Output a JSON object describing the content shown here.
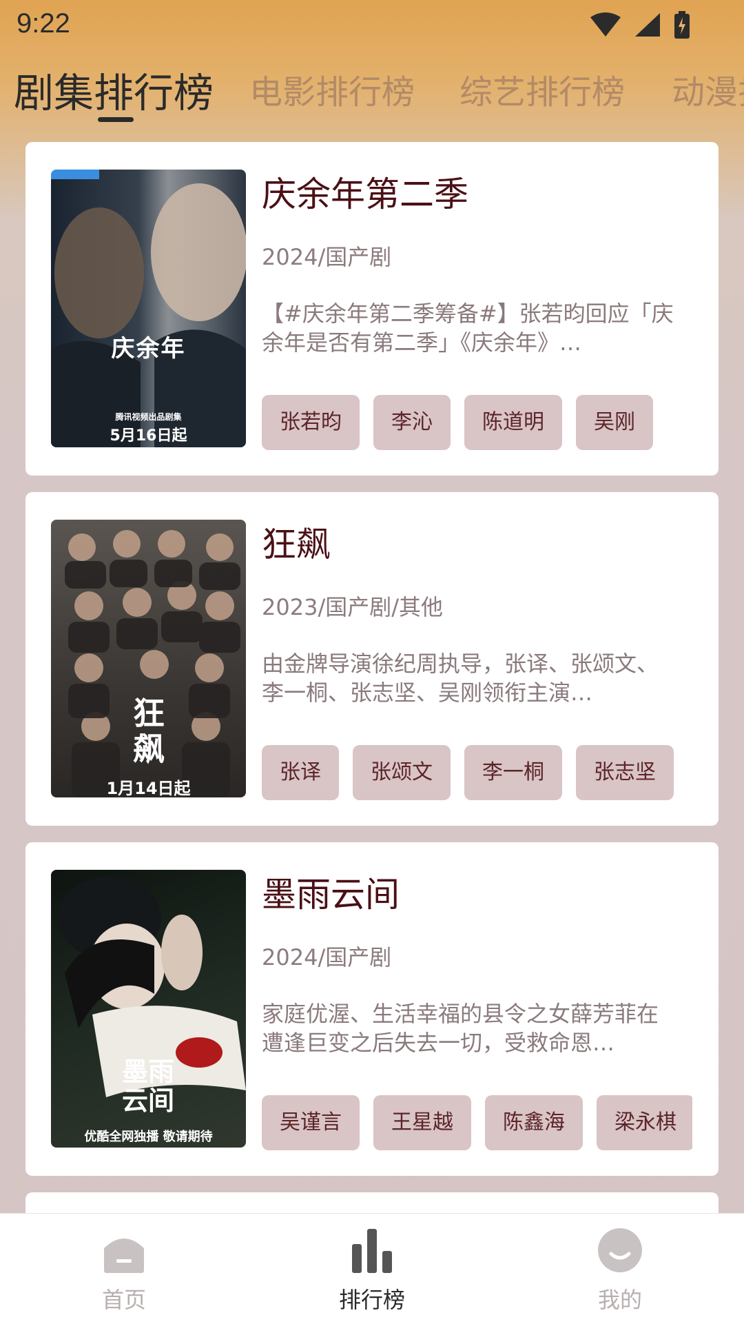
{
  "status_bar": {
    "time": "9:22"
  },
  "tabs": [
    {
      "label": "剧集排行榜",
      "active": true
    },
    {
      "label": "电影排行榜",
      "active": false
    },
    {
      "label": "综艺排行榜",
      "active": false
    },
    {
      "label": "动漫排",
      "active": false
    }
  ],
  "items": [
    {
      "title": "庆余年第二季",
      "meta": "2024/国产剧",
      "desc": "【#庆余年第二季筹备#】张若昀回应「庆余年是否有第二季」《庆余年》…",
      "tags": [
        "张若昀",
        "李沁",
        "陈道明",
        "吴刚"
      ],
      "poster": {
        "text_main": "庆余年",
        "text_date": "5月16日起",
        "text_sub": "腾讯视频出品剧集"
      }
    },
    {
      "title": "狂飙",
      "meta": "2023/国产剧/其他",
      "desc": "由金牌导演徐纪周执导，张译、张颂文、李一桐、张志坚、吴刚领衔主演…",
      "tags": [
        "张译",
        "张颂文",
        "李一桐",
        "张志坚"
      ],
      "poster": {
        "text_main": "狂飙",
        "text_date": "1月14日起"
      }
    },
    {
      "title": "墨雨云间",
      "meta": "2024/国产剧",
      "desc": "家庭优渥、生活幸福的县令之女薛芳菲在遭逢巨变之后失去一切，受救命恩…",
      "tags": [
        "吴谨言",
        "王星越",
        "陈鑫海",
        "梁永棋"
      ],
      "poster": {
        "text_main": "墨雨云间",
        "text_date": "优酷全网独播 敬请期待"
      }
    }
  ],
  "bottom_nav": [
    {
      "label": "首页",
      "icon": "home-icon",
      "active": false
    },
    {
      "label": "排行榜",
      "icon": "bar-chart-icon",
      "active": true
    },
    {
      "label": "我的",
      "icon": "profile-icon",
      "active": false
    }
  ],
  "colors": {
    "accent_dark": "#2a2a2a",
    "title": "#4a1016",
    "tag_bg": "#d9c4c6",
    "tab_inactive": "#b28a66"
  }
}
